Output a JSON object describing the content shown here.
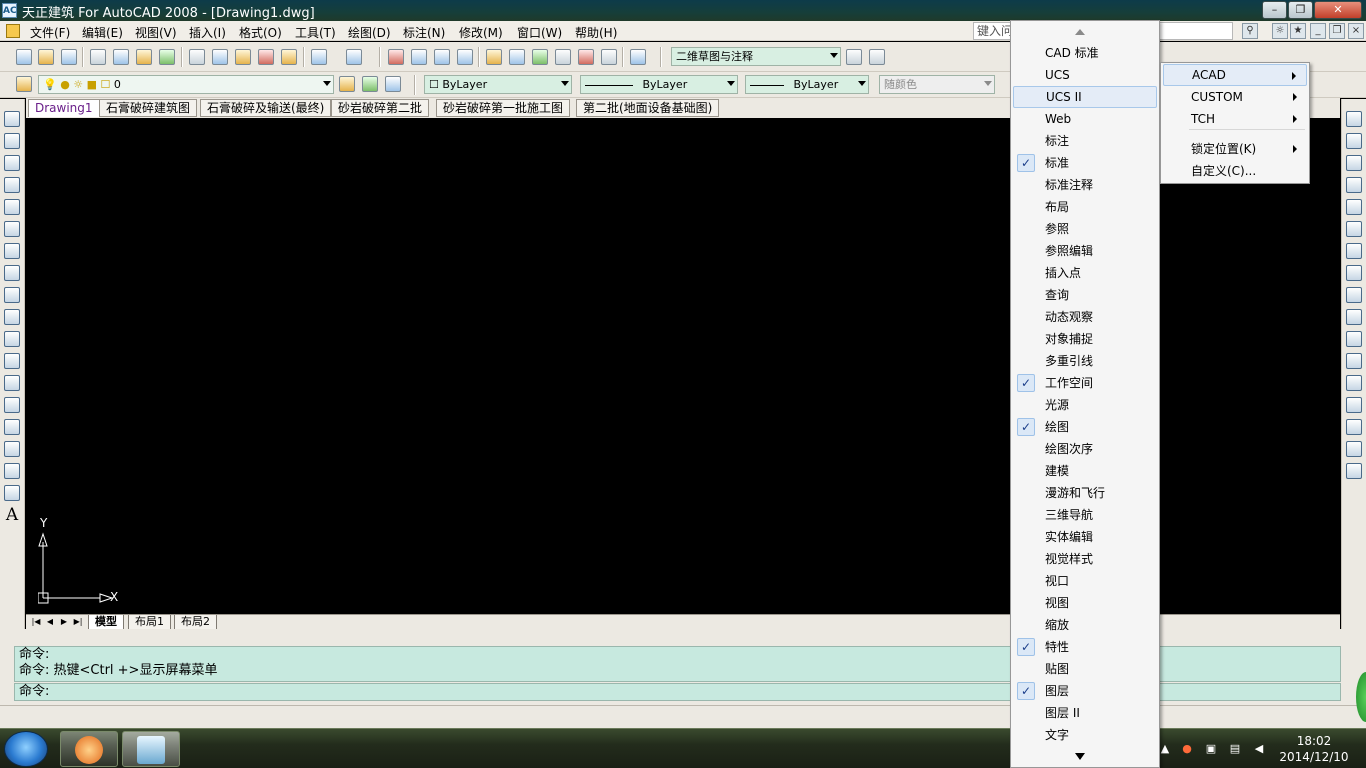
{
  "window": {
    "title": "天正建筑 For AutoCAD 2008 - [Drawing1.dwg]",
    "app_icon_label": "AC"
  },
  "menubar": {
    "items": [
      "文件(F)",
      "编辑(E)",
      "视图(V)",
      "插入(I)",
      "格式(O)",
      "工具(T)",
      "绘图(D)",
      "标注(N)",
      "修改(M)",
      "窗口(W)",
      "帮助(H)"
    ],
    "search_placeholder": "键入问"
  },
  "toolbar": {
    "workspace": "二维草图与注释",
    "layer": "0",
    "color": "ByLayer",
    "linetype": "ByLayer",
    "lineweight": "ByLayer",
    "plotstyle": "随颜色"
  },
  "doc_tabs": [
    "Drawing1",
    "石膏破碎建筑图",
    "石膏破碎及输送(最终)",
    "砂岩破碎第二批",
    "砂岩破碎第一批施工图",
    "第二批(地面设备基础图)"
  ],
  "layout_tabs": [
    "模型",
    "布局1",
    "布局2"
  ],
  "ucs": {
    "x_label": "X",
    "y_label": "Y"
  },
  "command": {
    "history": [
      "命令:",
      "命令: 热键<Ctrl +>显示屏幕菜单"
    ],
    "prompt": "命令:"
  },
  "context_menu": {
    "items": [
      {
        "label": "CAD 标准",
        "checked": false
      },
      {
        "label": "UCS",
        "checked": false
      },
      {
        "label": "UCS II",
        "checked": false,
        "hover": true
      },
      {
        "label": "Web",
        "checked": false
      },
      {
        "label": "标注",
        "checked": false
      },
      {
        "label": "标准",
        "checked": true
      },
      {
        "label": "标准注释",
        "checked": false
      },
      {
        "label": "布局",
        "checked": false
      },
      {
        "label": "参照",
        "checked": false
      },
      {
        "label": "参照编辑",
        "checked": false
      },
      {
        "label": "插入点",
        "checked": false
      },
      {
        "label": "查询",
        "checked": false
      },
      {
        "label": "动态观察",
        "checked": false
      },
      {
        "label": "对象捕捉",
        "checked": false
      },
      {
        "label": "多重引线",
        "checked": false
      },
      {
        "label": "工作空间",
        "checked": true
      },
      {
        "label": "光源",
        "checked": false
      },
      {
        "label": "绘图",
        "checked": true
      },
      {
        "label": "绘图次序",
        "checked": false
      },
      {
        "label": "建模",
        "checked": false
      },
      {
        "label": "漫游和飞行",
        "checked": false
      },
      {
        "label": "三维导航",
        "checked": false
      },
      {
        "label": "实体编辑",
        "checked": false
      },
      {
        "label": "视觉样式",
        "checked": false
      },
      {
        "label": "视口",
        "checked": false
      },
      {
        "label": "视图",
        "checked": false
      },
      {
        "label": "缩放",
        "checked": false
      },
      {
        "label": "特性",
        "checked": true
      },
      {
        "label": "贴图",
        "checked": false
      },
      {
        "label": "图层",
        "checked": true
      },
      {
        "label": "图层 II",
        "checked": false
      },
      {
        "label": "文字",
        "checked": false
      }
    ],
    "check_glyph": "✓"
  },
  "submenu": {
    "items": [
      {
        "label": "ACAD",
        "has_submenu": true,
        "hover": true
      },
      {
        "label": "CUSTOM",
        "has_submenu": true
      },
      {
        "label": "TCH",
        "has_submenu": true
      },
      {
        "label": "锁定位置(K)",
        "has_submenu": true
      },
      {
        "label": "自定义(C)...",
        "has_submenu": false
      }
    ]
  },
  "taskbar": {
    "time": "18:02",
    "date": "2014/12/10"
  }
}
